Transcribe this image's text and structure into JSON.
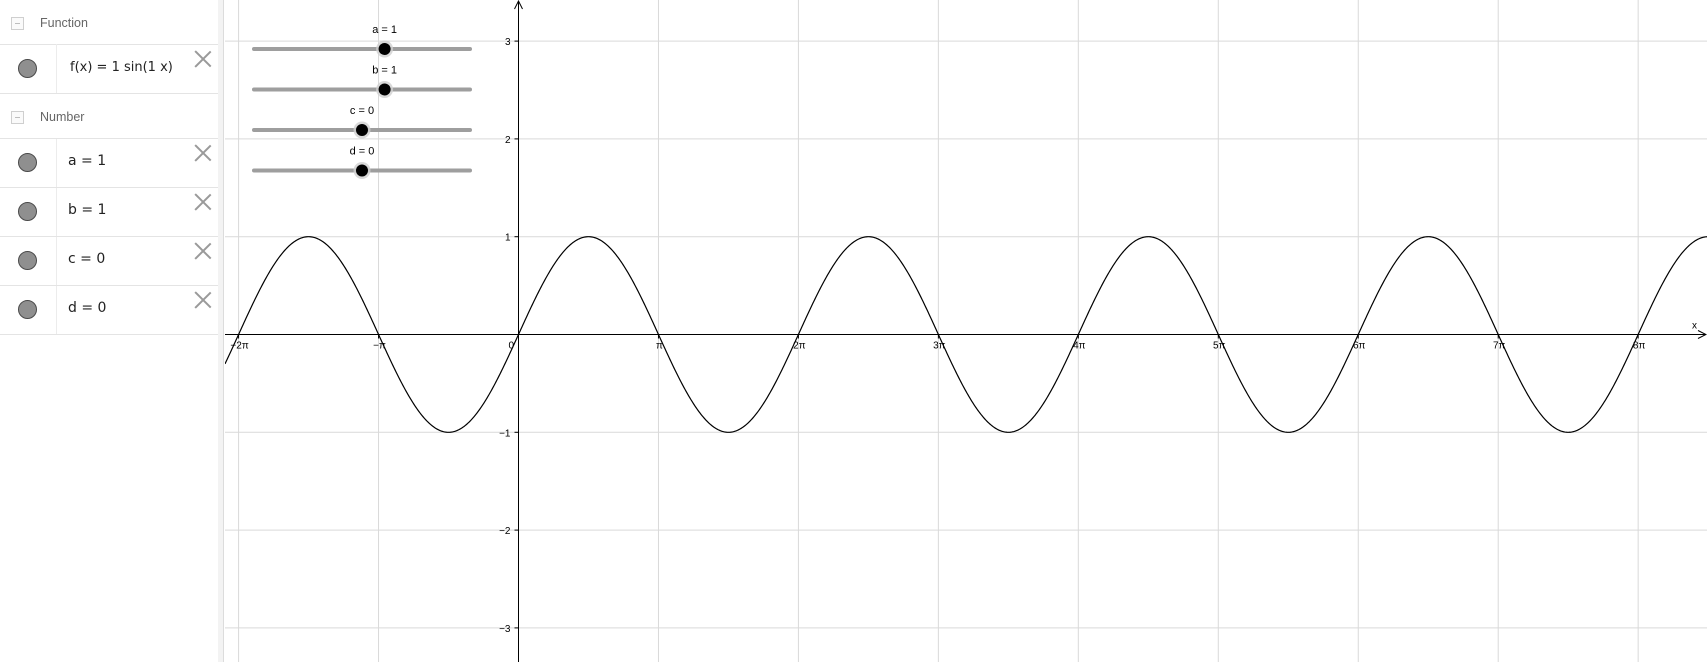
{
  "algebra": {
    "groups": [
      {
        "label": "Function",
        "rows": [
          {
            "text": "f(x) = 1 sin(1 x)"
          }
        ]
      },
      {
        "label": "Number",
        "rows": [
          {
            "text": "a = 1"
          },
          {
            "text": "b = 1"
          },
          {
            "text": "c = 0"
          },
          {
            "text": "d = 0"
          }
        ]
      }
    ]
  },
  "sliders": [
    {
      "name": "a",
      "label": "a = 1",
      "value": 1,
      "min": -5,
      "max": 5
    },
    {
      "name": "b",
      "label": "b = 1",
      "value": 1,
      "min": -5,
      "max": 5
    },
    {
      "name": "c",
      "label": "c = 0",
      "value": 0,
      "min": -5,
      "max": 5
    },
    {
      "name": "d",
      "label": "d = 0",
      "value": 0,
      "min": -5,
      "max": 5
    }
  ],
  "chart_data": {
    "type": "line",
    "xlabel": "x",
    "ylabel": "",
    "grid": true,
    "xlim": [
      -6.8,
      26.0
    ],
    "ylim": [
      -3.35,
      3.4
    ],
    "x_ticks": [
      {
        "value": -6.283185,
        "label": "−2π"
      },
      {
        "value": -3.141593,
        "label": "−π"
      },
      {
        "value": 0,
        "label": "0"
      },
      {
        "value": 3.141593,
        "label": "π"
      },
      {
        "value": 6.283185,
        "label": "2π"
      },
      {
        "value": 9.424778,
        "label": "3π"
      },
      {
        "value": 12.566371,
        "label": "4π"
      },
      {
        "value": 15.707963,
        "label": "5π"
      },
      {
        "value": 18.849556,
        "label": "6π"
      },
      {
        "value": 21.991149,
        "label": "7π"
      },
      {
        "value": 25.132741,
        "label": "8π"
      }
    ],
    "y_ticks": [
      {
        "value": 3,
        "label": "3"
      },
      {
        "value": 2,
        "label": "2"
      },
      {
        "value": 1,
        "label": "1"
      },
      {
        "value": -1,
        "label": "−1"
      },
      {
        "value": -2,
        "label": "−2"
      },
      {
        "value": -3,
        "label": "−3"
      }
    ],
    "series": [
      {
        "function": "1 sin(1 x)",
        "amplitude": 1,
        "frequency": 1,
        "phase": 0,
        "offset": 0,
        "color": "#000000"
      }
    ]
  },
  "colors": {
    "grid": "#d9d9d9",
    "axis": "#000000",
    "curve": "#000000",
    "slider_track": "#9e9e9e",
    "slider_knob": "#000000",
    "marble": "#8f8f8f"
  }
}
